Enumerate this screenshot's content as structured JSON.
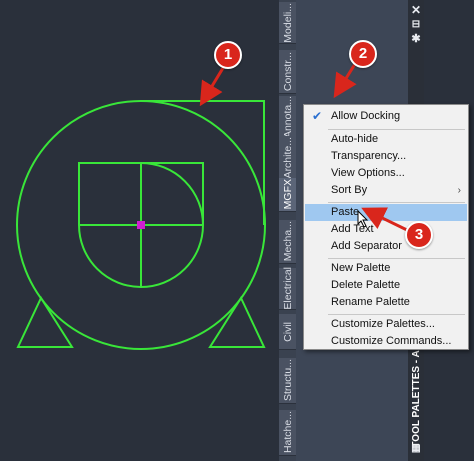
{
  "palette_tabs": [
    "Modeli...",
    "Constr...",
    "Annota...",
    "Archite...",
    "MGFX",
    "Mecha...",
    "Electrical",
    "Civil",
    "Structu...",
    "Hatche..."
  ],
  "active_tab": "MGFX",
  "palette_title": "TOOL PALETTES - ALL",
  "titlebar_icons": {
    "close": "close-icon",
    "pin": "pin-icon",
    "settings": "gear-icon",
    "properties": "properties-icon"
  },
  "context_menu": {
    "allow_docking": "Allow Docking",
    "auto_hide": "Auto-hide",
    "transparency": "Transparency...",
    "view_options": "View Options...",
    "sort_by": "Sort By",
    "paste": "Paste",
    "add_text": "Add Text",
    "add_separator": "Add Separator",
    "new_palette": "New Palette",
    "delete_palette": "Delete Palette",
    "rename_palette": "Rename Palette",
    "customize_palettes": "Customize Palettes...",
    "customize_commands": "Customize Commands..."
  },
  "callouts": [
    "1",
    "2",
    "3"
  ],
  "colors": {
    "drawing_stroke": "#39e639",
    "center_point": "#d020d0",
    "callout_red": "#d9261c",
    "menu_highlight": "#9fc8f0",
    "canvas_background": "#2a303b"
  }
}
